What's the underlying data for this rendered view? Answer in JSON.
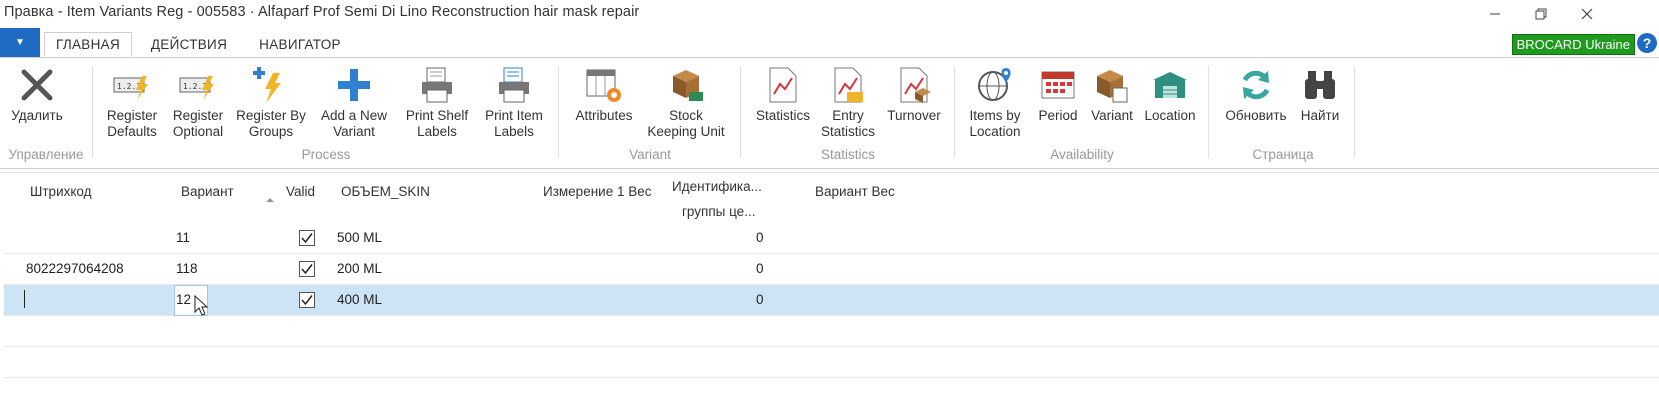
{
  "window": {
    "title": "Правка - Item Variants Reg - 005583 · Alfaparf Prof Semi Di Lino Reconstruction hair mask repair",
    "minimize_icon": "minimize-icon",
    "restore_icon": "restore-icon",
    "close_icon": "close-icon"
  },
  "tabs": {
    "app_menu": "▼",
    "items": [
      {
        "label": "ГЛАВНАЯ",
        "active": true
      },
      {
        "label": "ДЕЙСТВИЯ",
        "active": false
      },
      {
        "label": "НАВИГАТОР",
        "active": false
      }
    ],
    "company": "BROCARD Ukraine",
    "help": "?"
  },
  "ribbon": {
    "groups": [
      {
        "label": "Управление",
        "buttons": [
          {
            "label": "Удалить",
            "icon": "delete-x-icon"
          }
        ]
      },
      {
        "label": "Process",
        "buttons": [
          {
            "label": "Register\nDefaults",
            "icon": "register-defaults-icon"
          },
          {
            "label": "Register\nOptional",
            "icon": "register-optional-icon"
          },
          {
            "label": "Register By\nGroups",
            "icon": "register-groups-icon"
          },
          {
            "label": "Add a New\nVariant",
            "icon": "add-plus-icon"
          },
          {
            "label": "Print Shelf\nLabels",
            "icon": "print-shelf-icon"
          },
          {
            "label": "Print Item\nLabels",
            "icon": "print-item-icon"
          }
        ]
      },
      {
        "label": "Variant",
        "buttons": [
          {
            "label": "Attributes",
            "icon": "attributes-icon"
          },
          {
            "label": "Stock\nKeeping Unit",
            "icon": "sku-box-icon"
          }
        ]
      },
      {
        "label": "Statistics",
        "buttons": [
          {
            "label": "Statistics",
            "icon": "statistics-icon"
          },
          {
            "label": "Entry\nStatistics",
            "icon": "entry-statistics-icon"
          },
          {
            "label": "Turnover",
            "icon": "turnover-icon"
          }
        ]
      },
      {
        "label": "Availability",
        "buttons": [
          {
            "label": "Items by\nLocation",
            "icon": "globe-location-icon"
          },
          {
            "label": "Period",
            "icon": "calendar-period-icon"
          },
          {
            "label": "Variant",
            "icon": "variant-box-icon"
          },
          {
            "label": "Location",
            "icon": "warehouse-icon"
          }
        ]
      },
      {
        "label": "Страница",
        "buttons": [
          {
            "label": "Обновить",
            "icon": "refresh-icon"
          },
          {
            "label": "Найти",
            "icon": "binoculars-icon"
          }
        ]
      }
    ]
  },
  "grid": {
    "columns": [
      "Штрихкод",
      "Вариант",
      "Valid",
      "ОБЪЕМ_SKIN",
      "Измерение 1 Вес",
      "Идентифика...",
      "группы це...",
      "Вариант Вес"
    ],
    "rows": [
      {
        "barcode": "",
        "variant": "11",
        "valid": true,
        "volume": "500 ML",
        "price_group": "0"
      },
      {
        "barcode": "8022297064208",
        "variant": "118",
        "valid": true,
        "volume": "200 ML",
        "price_group": "0"
      },
      {
        "barcode": "",
        "variant": "12",
        "valid": true,
        "volume": "400 ML",
        "price_group": "0",
        "selected": true
      }
    ]
  },
  "colors": {
    "accent": "#1f6ac2",
    "company_badge": "#1e9a1e",
    "selected_row": "#cde4f7"
  }
}
